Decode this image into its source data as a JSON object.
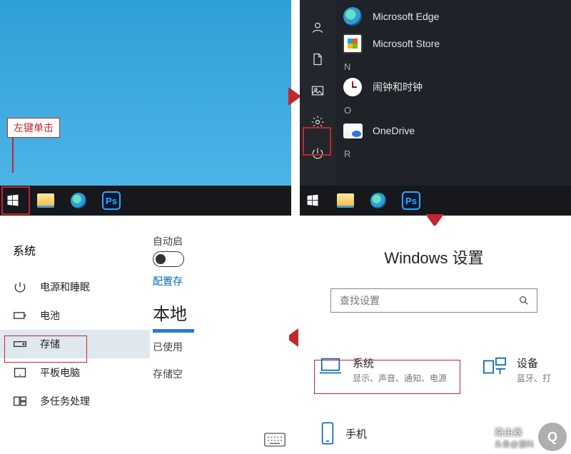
{
  "tl": {
    "tooltip": "左键单击",
    "taskbar": {
      "ps": "Ps"
    }
  },
  "tr": {
    "apps": {
      "edge": "Microsoft Edge",
      "store": "Microsoft Store",
      "hdr_n": "N",
      "clock": "闹钟和时钟",
      "hdr_o": "O",
      "onedrive": "OneDrive",
      "hdr_r": "R"
    },
    "taskbar": {
      "ps": "Ps"
    }
  },
  "br": {
    "title": "Windows 设置",
    "search_placeholder": "查找设置",
    "system": {
      "title": "系统",
      "sub": "显示、声音、通知、电源"
    },
    "devices": {
      "title": "设备",
      "sub": "蓝牙、打"
    },
    "phone": "手机"
  },
  "bl": {
    "header": "系统",
    "nav": {
      "power": "电源和睡眠",
      "battery": "电池",
      "storage": "存储",
      "tablet": "平板电脑",
      "multitask": "多任务处理"
    },
    "right": {
      "autostart": "自动启",
      "config": "配置存",
      "local": "本地",
      "used": "已使用",
      "space": "存储空"
    }
  },
  "watermark": {
    "brand": "路由器",
    "author": "头条@漫科"
  }
}
